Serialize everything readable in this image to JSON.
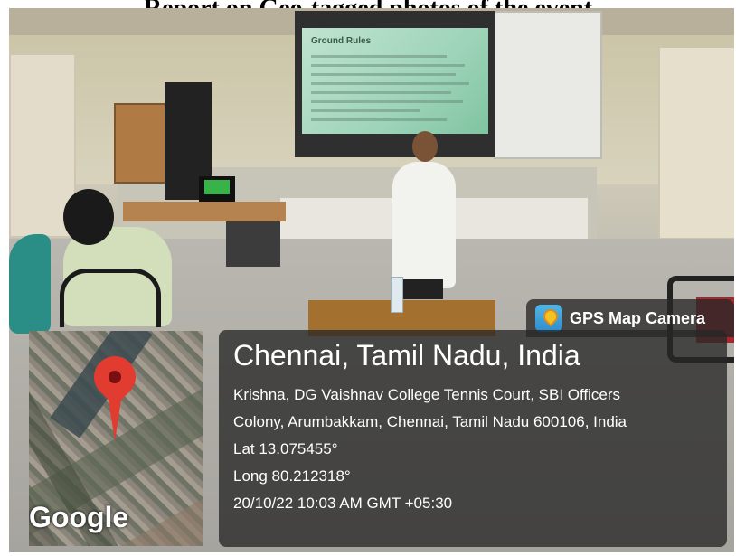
{
  "page": {
    "title": "Report on Geo-tagged photos of the event"
  },
  "photo": {
    "slide_title": "Ground Rules"
  },
  "gps_badge": {
    "label": "GPS Map Camera",
    "icon": "map-pin-app-icon"
  },
  "location": {
    "title": "Chennai, Tamil Nadu, India",
    "address_line1": "Krishna, DG Vaishnav College Tennis Court, SBI Officers",
    "address_line2": "Colony, Arumbakkam, Chennai, Tamil Nadu 600106, India",
    "lat": "Lat 13.075455°",
    "long": "Long 80.212318°",
    "timestamp": "20/10/22 10:03 AM GMT +05:30"
  },
  "map": {
    "provider": "Google",
    "pin_color": "#e23b30"
  }
}
